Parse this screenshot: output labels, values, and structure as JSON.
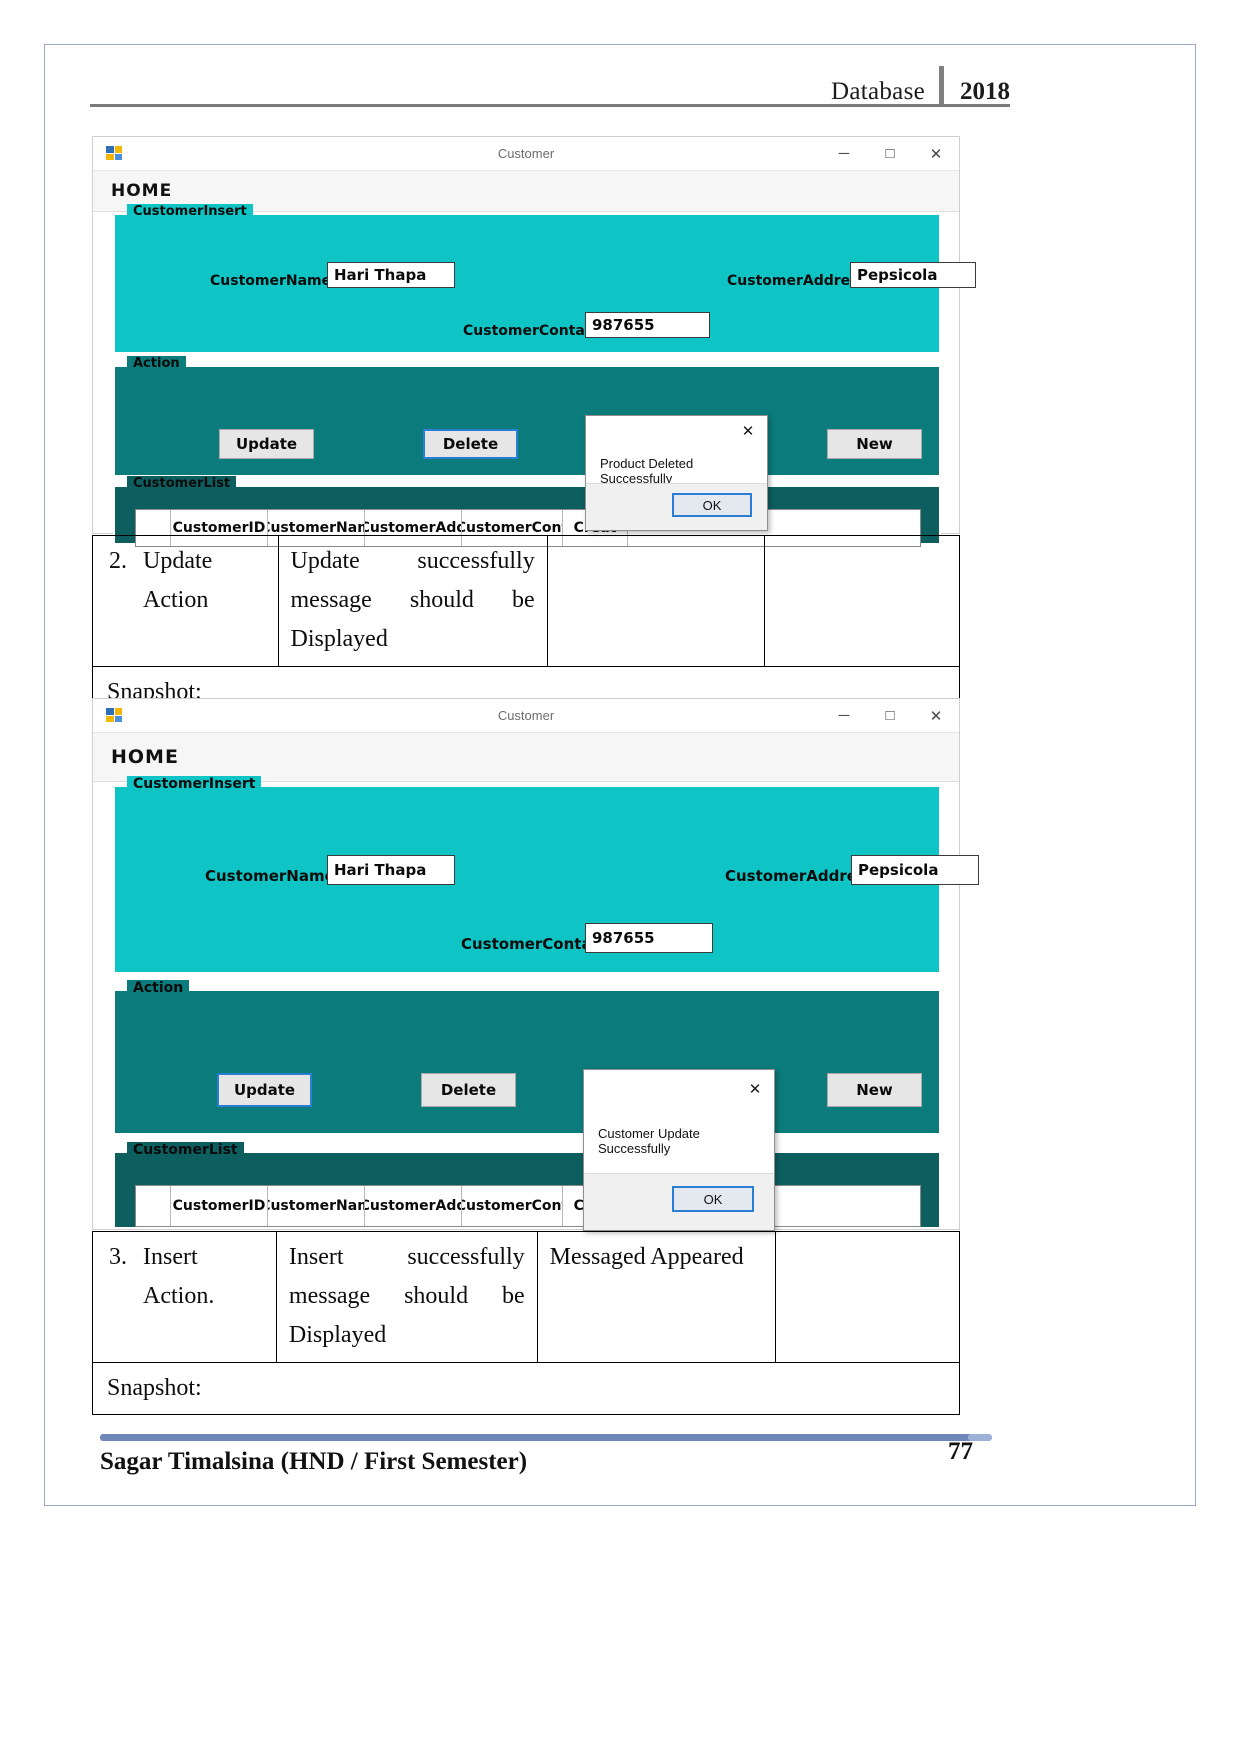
{
  "document": {
    "header": {
      "title": "Database",
      "year": "2018"
    },
    "footer": {
      "author": "Sagar Timalsina (HND / First Semester)",
      "page_number": "77"
    }
  },
  "colors": {
    "insert_group": "#0ec4c4",
    "action_group": "#0b7b7b",
    "list_group": "#0d5f5f",
    "focus_border": "#2a7fd4",
    "footer_rule": "#6f86b8"
  },
  "screenshot_one": {
    "titlebar": {
      "title": "Customer",
      "icon": "app-window-icon",
      "minimize": "─",
      "maximize": "□",
      "close": "✕"
    },
    "menu": {
      "home": "HOME"
    },
    "insert_group": {
      "label": "CustomerInsert",
      "fields": [
        {
          "label": "CustomerName:",
          "value": "Hari Thapa"
        },
        {
          "label": "CustomerAddress:",
          "value": "Pepsicola"
        },
        {
          "label": "CustomerContact:",
          "value": "987655"
        }
      ]
    },
    "action_group": {
      "label": "Action",
      "buttons": [
        "Update",
        "Delete",
        "New"
      ]
    },
    "list_group": {
      "label": "CustomerList",
      "columns": [
        "CustomerID",
        "CustomerNam",
        "CustomerAdd",
        "CustomerCont",
        "Creat"
      ]
    },
    "dialog": {
      "message": "Product Deleted Successfully",
      "ok_label": "OK",
      "close_label": "✕"
    }
  },
  "screenshot_two": {
    "titlebar": {
      "title": "Customer",
      "icon": "app-window-icon",
      "minimize": "─",
      "maximize": "□",
      "close": "✕"
    },
    "menu": {
      "home": "HOME"
    },
    "insert_group": {
      "label": "CustomerInsert",
      "fields": [
        {
          "label": "CustomerName:",
          "value": "Hari Thapa"
        },
        {
          "label": "CustomerAddress:",
          "value": "Pepsicola"
        },
        {
          "label": "CustomerContact:",
          "value": "987655"
        }
      ]
    },
    "action_group": {
      "label": "Action",
      "buttons": [
        "Update",
        "Delete",
        "New"
      ]
    },
    "list_group": {
      "label": "CustomerList",
      "columns": [
        "CustomerID",
        "CustomerNam",
        "CustomerAdd",
        "CustomerCont",
        "Creat"
      ]
    },
    "dialog": {
      "message": "Customer Update Successfully",
      "ok_label": "OK",
      "close_label": "✕"
    }
  },
  "table": {
    "row2": {
      "number": "2.",
      "action": "Update",
      "action_line2": "Action",
      "expected_line1": "Update",
      "expected_line1b": "successfully",
      "expected_line2": "message",
      "expected_line2b": "should",
      "expected_line2c": "be",
      "expected_line3": "Displayed",
      "actual": "",
      "remarks": ""
    },
    "snapshot_label_1": "Snapshot:",
    "row3": {
      "number": "3.",
      "action": "Insert",
      "action_line2": "Action.",
      "expected_line1": "Insert",
      "expected_line1b": "successfully",
      "expected_line2": "message",
      "expected_line2b": "should",
      "expected_line2c": "be",
      "expected_line3": "Displayed",
      "actual": "Messaged Appeared",
      "remarks": ""
    },
    "snapshot_label_2": "Snapshot:"
  }
}
